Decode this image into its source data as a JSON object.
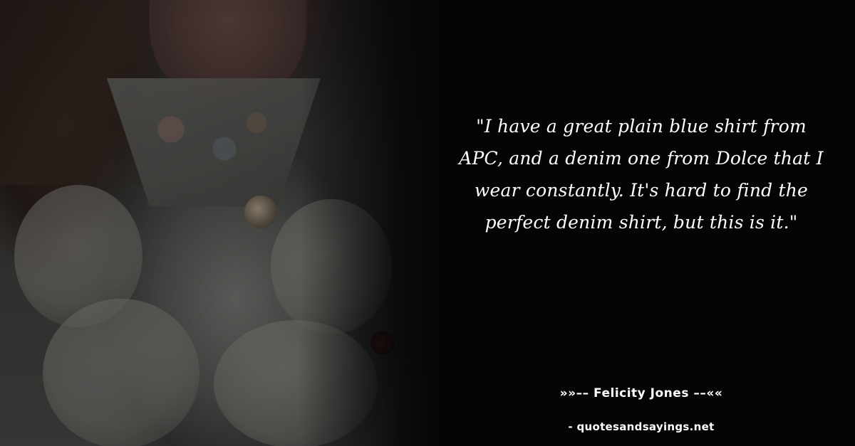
{
  "quote": {
    "text": "\"I have a great plain blue shirt from APC, and a denim one from Dolce that I wear constantly. It's hard to find the perfect denim shirt, but this is it.\""
  },
  "author": {
    "label": "»»–– Felicity Jones ––««"
  },
  "source": {
    "label": "- quotesandsayings.net"
  },
  "colors": {
    "background": "#050505",
    "text": "#ffffff"
  }
}
